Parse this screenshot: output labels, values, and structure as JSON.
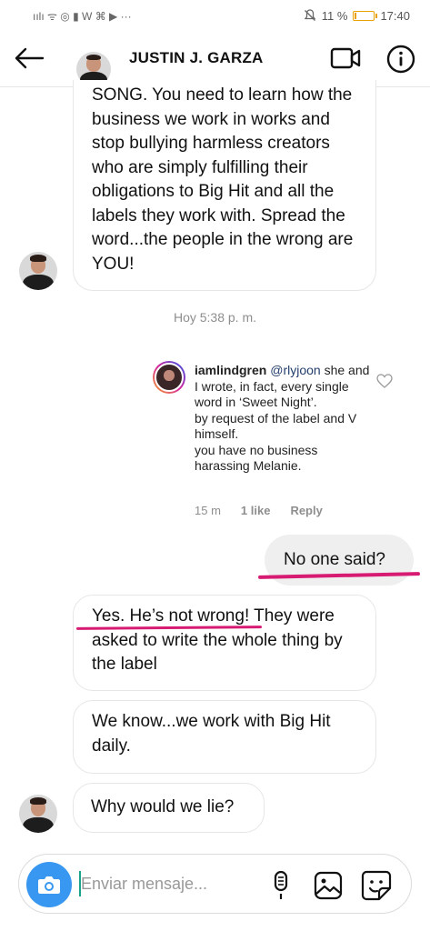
{
  "status_bar": {
    "signal_icons": "ıılı ᯤ ◎ ▮ W ⌘ ▶ ···",
    "battery_percent": "11 %",
    "battery_level": 0.11,
    "time": "17:40"
  },
  "header": {
    "contact_name": "JUSTIN J. GARZA"
  },
  "messages": [
    {
      "text": "SONG. You need to learn how the business we work in works and stop bullying harmless creators who are simply fulfilling their obligations to Big Hit and all the labels they work with. Spread the word...the people in the wrong are YOU!"
    }
  ],
  "timestamp": "Hoy 5:38 p. m.",
  "shared_comment": {
    "username": "iamlindgren",
    "mention": "@rlyjoon",
    "body_1": " she and I wrote, in fact, every single word in ‘Sweet Night’.",
    "body_2": "by request of the label and V himself.",
    "body_3": "you have no business harassing Melanie.",
    "age": "15 m",
    "likes": "1 like",
    "reply": "Reply"
  },
  "sent_message": "No one said?",
  "reply_1": {
    "underlined": "Yes. He’s not wrong",
    "rest": "! They were asked to write the whole thing by the label"
  },
  "reply_2": "We know...we work with Big Hit daily.",
  "reply_3": "Why would we lie?",
  "composer": {
    "placeholder": "Enviar mensaje..."
  },
  "colors": {
    "accent_blue": "#3897f0",
    "highlight_underline": "#d81b72",
    "battery": "#e8a100"
  }
}
